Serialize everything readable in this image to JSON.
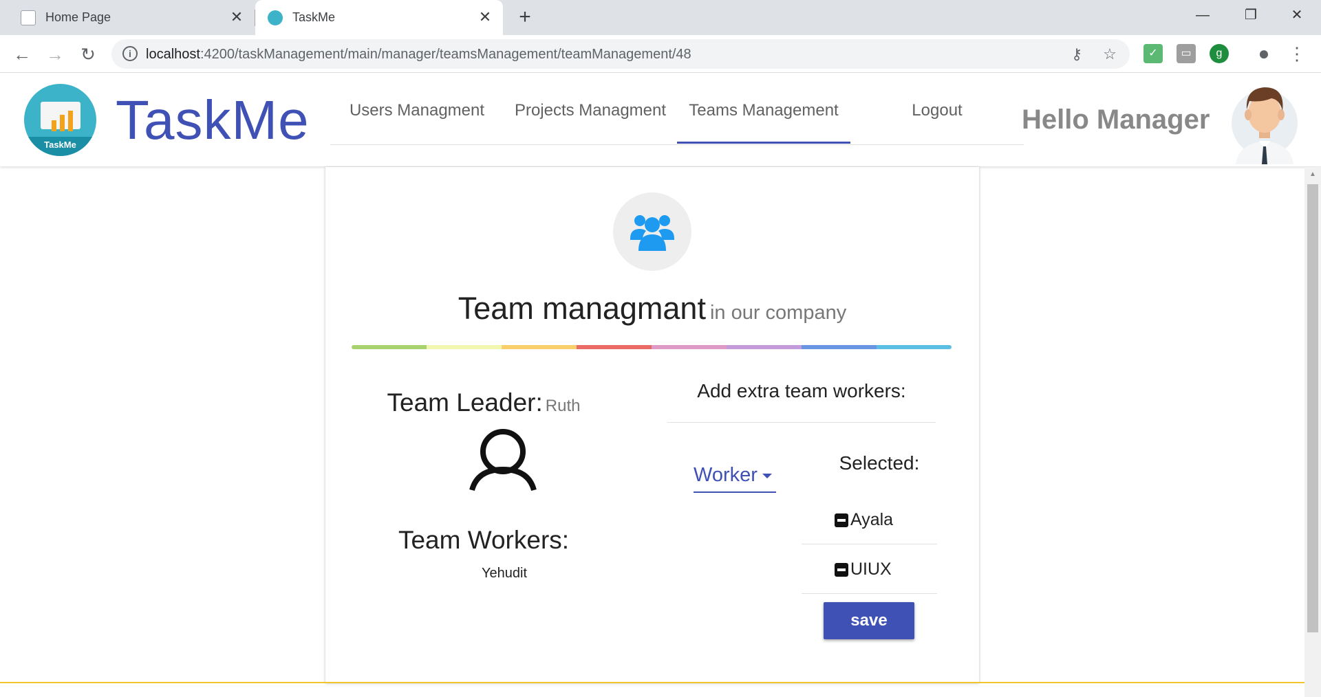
{
  "browser": {
    "tabs": [
      {
        "title": "Home Page",
        "active": false
      },
      {
        "title": "TaskMe",
        "active": true
      }
    ],
    "new_tab_symbol": "+",
    "close_symbol": "✕",
    "window_controls": {
      "minimize": "—",
      "restore": "❐",
      "close": "✕"
    },
    "url_host": "localhost",
    "url_rest": ":4200/taskManagement/main/manager/teamsManagement/teamManagement/48"
  },
  "header": {
    "logo_caption": "TaskMe",
    "brand": "TaskMe",
    "nav": [
      {
        "label": "Users Managment",
        "active": false
      },
      {
        "label": "Projects Managment",
        "active": false
      },
      {
        "label": "Teams Management",
        "active": true
      },
      {
        "label": "Logout",
        "active": false
      }
    ],
    "greeting": "Hello Manager"
  },
  "card": {
    "title": "Team managmant",
    "subtitle": "in our company",
    "leader_label": "Team Leader:",
    "leader_name": "Ruth",
    "workers_label": "Team Workers:",
    "workers": [
      "Yehudit"
    ],
    "add_title": "Add extra team workers:",
    "worker_select": {
      "value": "Worker"
    },
    "selected_label": "Selected:",
    "selected": [
      "Ayala",
      "UIUX"
    ],
    "save_label": "save"
  },
  "colors": {
    "accent": "#3f51b5",
    "team_icon": "#1e9bf0",
    "footer_line": "#f2c52c",
    "rainbow": [
      "#a8d26e",
      "#f2f7b0",
      "#f9cf6b",
      "#ea6b66",
      "#dd9ac7",
      "#c39bdb",
      "#6a95e3",
      "#5bbfe3"
    ]
  },
  "icons": {
    "back": "arrow-left-icon",
    "forward": "arrow-right-icon",
    "reload": "reload-icon",
    "info": "info-icon",
    "key": "key-icon",
    "star": "star-icon",
    "account": "account-icon",
    "menu": "kebab-menu-icon"
  }
}
